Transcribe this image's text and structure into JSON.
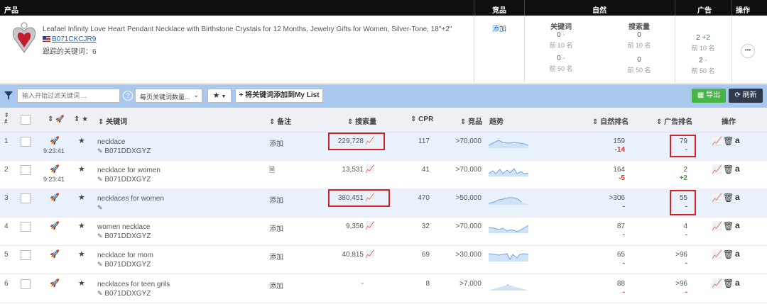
{
  "header": {
    "product": "产品",
    "competing": "竞品",
    "natural": "自然",
    "ads": "广告",
    "actions": "操作"
  },
  "product": {
    "title": "Leafael Infinity Love Heart Pendant Necklace with Birthstone Crystals for 12 Months, Jewelry Gifts for Women, Silver-Tone, 18\"+2\"",
    "asin": "B071CKCJR9",
    "tracked": "跟踪的关键词：6",
    "add": "添加",
    "kw_label": "关键词",
    "sv_label": "搜索量",
    "kw_top10": "0",
    "kw_top10_delta": "-",
    "kw_top10_label": "前 10 名",
    "kw_top50": "0",
    "kw_top50_delta": "-",
    "kw_top50_label": "前 50 名",
    "sv_top10": "0",
    "sv_top10_label": "前 10 名",
    "sv_top50": "0",
    "sv_top50_label": "前 50 名",
    "ad_top10": "2",
    "ad_top10_delta": "+2",
    "ad_top10_label": "前 10 名",
    "ad_top50": "2",
    "ad_top50_delta": "-",
    "ad_top50_label": "前 50 名",
    "more": "•••"
  },
  "toolbar": {
    "filter_placeholder": "输入开始过滤关键词 ...",
    "help": "?",
    "per_page": "每页关键词数量...",
    "add_btn": "+ 将关键词添加到My List",
    "export": "导出",
    "refresh": "刷新"
  },
  "columns": {
    "num": "#",
    "keyword": "关键词",
    "note": "备注",
    "search": "搜索量",
    "cpr": "CPR",
    "competing": "竞品",
    "trend": "趋势",
    "natural_rank": "自然排名",
    "ad_rank": "广告排名",
    "actions": "操作"
  },
  "rows": [
    {
      "n": "1",
      "time": "9:23:41",
      "kw": "necklace",
      "asin": "B071DDXGYZ",
      "note": "添加",
      "sv": "229,728",
      "cpr": "117",
      "comp": ">70,000",
      "nat": "159",
      "nat_d": "-14",
      "ad": "79",
      "ad_d": "-"
    },
    {
      "n": "2",
      "time": "9:23:41",
      "kw": "necklace for women",
      "asin": "B071DDXGYZ",
      "note": "",
      "sv": "13,531",
      "cpr": "41",
      "comp": ">70,000",
      "nat": "164",
      "nat_d": "-5",
      "ad": "2",
      "ad_d": "+2"
    },
    {
      "n": "3",
      "time": "",
      "kw": "necklaces for women",
      "asin": "",
      "note": "添加",
      "sv": "380,451",
      "cpr": "470",
      "comp": ">50,000",
      "nat": ">306",
      "nat_d": "-",
      "ad": "55",
      "ad_d": "-"
    },
    {
      "n": "4",
      "time": "",
      "kw": "women necklace",
      "asin": "B071DDXGYZ",
      "note": "添加",
      "sv": "9,356",
      "cpr": "32",
      "comp": ">70,000",
      "nat": "87",
      "nat_d": "-",
      "ad": "4",
      "ad_d": "-"
    },
    {
      "n": "5",
      "time": "",
      "kw": "necklace for mom",
      "asin": "B071DDXGYZ",
      "note": "添加",
      "sv": "40,815",
      "cpr": "69",
      "comp": ">30,000",
      "nat": "65",
      "nat_d": "-",
      "ad": ">96",
      "ad_d": "-"
    },
    {
      "n": "6",
      "time": "",
      "kw": "necklaces for teen grils",
      "asin": "B071DDXGYZ",
      "note": "添加",
      "sv": "-",
      "cpr": "8",
      "comp": ">7,000",
      "nat": "88",
      "nat_d": "-",
      "ad": ">96",
      "ad_d": "-"
    }
  ]
}
